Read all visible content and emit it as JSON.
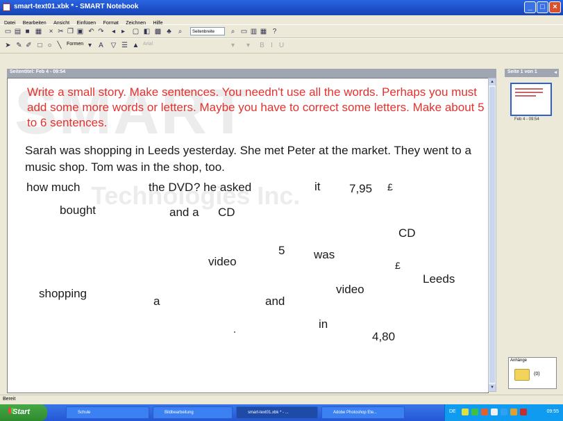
{
  "window": {
    "title": "smart-text01.xbk * - SMART Notebook"
  },
  "menu": [
    "Datei",
    "Bearbeiten",
    "Ansicht",
    "Einfügen",
    "Format",
    "Zeichnen",
    "Hilfe"
  ],
  "toolbar": {
    "view_select": "Seitenbreite",
    "shapes_label": "Formen",
    "font_select": "Arial"
  },
  "doc_tab": {
    "label": "Seitentitel: Feb 4 - 09:54"
  },
  "page": {
    "watermark": {
      "line1": "SMART",
      "line2": "Technologies Inc."
    },
    "instruction": "Write a small story. Make sentences. You needn't use all the words. Perhaps you must add some more words or letters. Maybe you have to correct some letters. Make about 5 to 6 sentences.",
    "paragraph": "Sarah was shopping in Leeds yesterday. She met Peter at the market. They went to a music shop. Tom was in the shop, too.",
    "words": {
      "how_much": "how much",
      "the_dvd": "the DVD",
      "he_asked": "? he asked",
      "it": "it",
      "price_795": "7,95",
      "pound_1": "£",
      "bought": "bought",
      "and_a": "and a",
      "cd_1": "CD",
      "cd_2": "CD",
      "five": "5",
      "video_1": "video",
      "was": "was",
      "pound_2": "£",
      "leeds": "Leeds",
      "video_2": "video",
      "shopping": "shopping",
      "a": "a",
      "and": "and",
      "in": "in",
      "price_480": "4,80"
    }
  },
  "sidebar": {
    "header": "Seite 1 von 1",
    "thumb_label": "Feb 4 - 09:54",
    "attachments_label": "Anhänge",
    "attachments_count": "(0)"
  },
  "status": {
    "text": "Bereit"
  },
  "taskbar": {
    "start": "Start",
    "tasks": [
      "Schule",
      "Bildbearbeitung",
      "smart-text01.xbk * - ...",
      "Adobe Photoshop Ele..."
    ],
    "lang": "DE",
    "clock": "09:55"
  },
  "colors": {
    "instruction": "#e5312d",
    "titlebar": "#1c4fc7",
    "taskbar": "#2457d6"
  }
}
